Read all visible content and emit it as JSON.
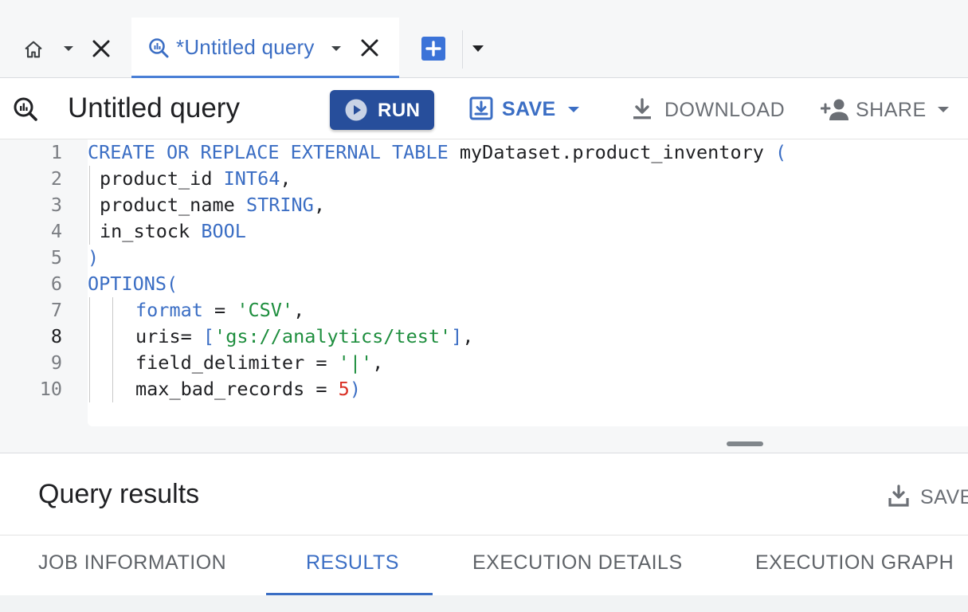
{
  "tabs": {
    "home": {
      "icon": "home-icon"
    },
    "query": {
      "label": "*Untitled query",
      "icon": "query-icon"
    },
    "new_tab": {
      "icon": "plus-icon"
    }
  },
  "toolbar": {
    "title": "Untitled query",
    "run_label": "RUN",
    "save_label": "SAVE",
    "download_label": "DOWNLOAD",
    "share_label": "SHARE"
  },
  "editor": {
    "lines": [
      {
        "number": "1",
        "tokens": [
          {
            "t": "CREATE OR REPLACE EXTERNAL TABLE ",
            "c": "kw"
          },
          {
            "t": "myDataset.product_inventory ",
            "c": ""
          },
          {
            "t": "(",
            "c": "kw"
          }
        ]
      },
      {
        "number": "2",
        "tokens": [
          {
            "t": "product_id ",
            "c": ""
          },
          {
            "t": "INT64",
            "c": "kw"
          },
          {
            "t": ",",
            "c": ""
          }
        ]
      },
      {
        "number": "3",
        "tokens": [
          {
            "t": "product_name ",
            "c": ""
          },
          {
            "t": "STRING",
            "c": "kw"
          },
          {
            "t": ",",
            "c": ""
          }
        ]
      },
      {
        "number": "4",
        "tokens": [
          {
            "t": "in_stock ",
            "c": ""
          },
          {
            "t": "BOOL",
            "c": "kw"
          }
        ]
      },
      {
        "number": "5",
        "tokens": [
          {
            "t": ")",
            "c": "kw"
          }
        ]
      },
      {
        "number": "6",
        "tokens": [
          {
            "t": "OPTIONS(",
            "c": "kw"
          }
        ]
      },
      {
        "number": "7",
        "tokens": [
          {
            "t": "format",
            "c": "kw"
          },
          {
            "t": " = ",
            "c": ""
          },
          {
            "t": "'CSV'",
            "c": "str"
          },
          {
            "t": ",",
            "c": ""
          }
        ]
      },
      {
        "number": "8",
        "tokens": [
          {
            "t": "uris= ",
            "c": ""
          },
          {
            "t": "[",
            "c": "kw"
          },
          {
            "t": "'gs://analytics/test'",
            "c": "str"
          },
          {
            "t": "]",
            "c": "kw"
          },
          {
            "t": ",",
            "c": ""
          }
        ]
      },
      {
        "number": "9",
        "tokens": [
          {
            "t": "field_delimiter = ",
            "c": ""
          },
          {
            "t": "'|'",
            "c": "str"
          },
          {
            "t": ",",
            "c": ""
          }
        ]
      },
      {
        "number": "10",
        "tokens": [
          {
            "t": "max_bad_records = ",
            "c": ""
          },
          {
            "t": "5",
            "c": "num"
          },
          {
            "t": ")",
            "c": "kw"
          }
        ]
      }
    ],
    "active_line": "8"
  },
  "results": {
    "title": "Query results",
    "save_label": "SAVE",
    "tabs": [
      {
        "label": "JOB INFORMATION"
      },
      {
        "label": "RESULTS",
        "active": true
      },
      {
        "label": "EXECUTION DETAILS"
      },
      {
        "label": "EXECUTION GRAPH"
      }
    ]
  },
  "colors": {
    "accent": "#3b6ec4",
    "run_button": "#274e9b",
    "keyword": "#3b6ec4",
    "string": "#1e8e3e",
    "number": "#d93025"
  }
}
